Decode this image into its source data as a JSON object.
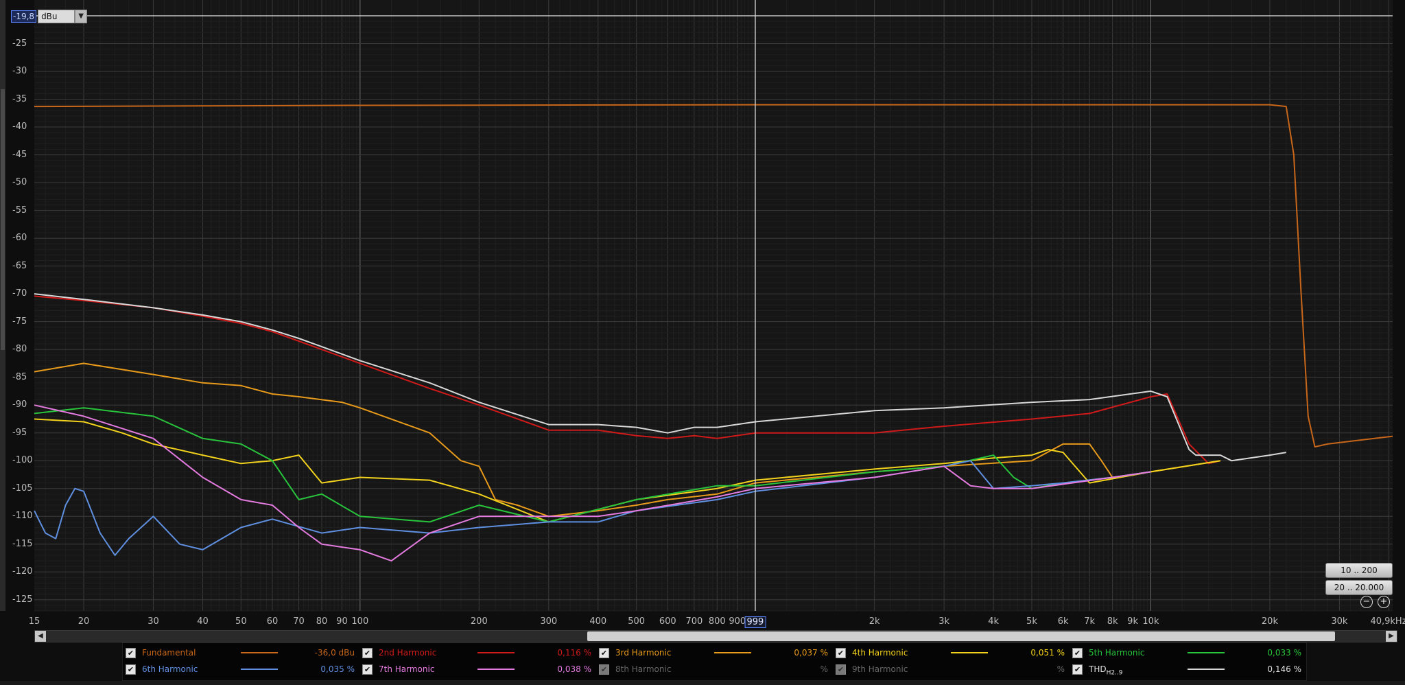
{
  "unit": {
    "cursor_level": "-19,8",
    "selected": "dBu"
  },
  "y_ticks": [
    "-25",
    "-30",
    "-35",
    "-40",
    "-45",
    "-50",
    "-55",
    "-60",
    "-65",
    "-70",
    "-75",
    "-80",
    "-85",
    "-90",
    "-95",
    "-100",
    "-105",
    "-110",
    "-115",
    "-120",
    "-125"
  ],
  "x_ticks": [
    "15",
    "20",
    "30",
    "40",
    "50",
    "60",
    "70",
    "80",
    "90",
    "100",
    "200",
    "300",
    "400",
    "500",
    "600",
    "700",
    "800",
    "900",
    "999",
    "2k",
    "3k",
    "4k",
    "5k",
    "6k",
    "7k",
    "8k",
    "9k",
    "10k",
    "20k",
    "30k",
    "40,9kHz"
  ],
  "cursor_freq": "999",
  "buttons": {
    "range_1": "10 .. 200",
    "range_2": "20 .. 20.000"
  },
  "legend": [
    {
      "name": "Fundamental",
      "value": "-36,0 dBu",
      "color": "#c8661a",
      "checked": true,
      "enabled": true
    },
    {
      "name": "2nd Harmonic",
      "value": "0,116 %",
      "color": "#d01a1a",
      "checked": true,
      "enabled": true
    },
    {
      "name": "3rd Harmonic",
      "value": "0,037 %",
      "color": "#e89a1a",
      "checked": true,
      "enabled": true
    },
    {
      "name": "4th Harmonic",
      "value": "0,051 %",
      "color": "#f2d21c",
      "checked": true,
      "enabled": true
    },
    {
      "name": "5th Harmonic",
      "value": "0,033 %",
      "color": "#28c43c",
      "checked": true,
      "enabled": true
    },
    {
      "name": "6th Harmonic",
      "value": "0,035 %",
      "color": "#5f8fe0",
      "checked": true,
      "enabled": true
    },
    {
      "name": "7th Harmonic",
      "value": "0,038 %",
      "color": "#e47be0",
      "checked": true,
      "enabled": true
    },
    {
      "name": "8th Harmonic",
      "value": "%",
      "color": "#666666",
      "checked": true,
      "enabled": false
    },
    {
      "name": "9th Harmonic",
      "value": "%",
      "color": "#666666",
      "checked": true,
      "enabled": false
    },
    {
      "name": "THD",
      "name_sub": "H2..9",
      "value": "0,146 %",
      "color": "#d8d8d8",
      "checked": true,
      "enabled": true
    }
  ],
  "chart_data": {
    "type": "line",
    "title": "",
    "xlabel": "",
    "ylabel": "",
    "x_scale": "log",
    "xlim": [
      15,
      40900
    ],
    "ylim": [
      -127,
      -20
    ],
    "grid": true,
    "cursor": {
      "x": 999,
      "y": -19.8
    },
    "series": [
      {
        "name": "Fundamental",
        "color": "#c8661a",
        "x": [
          15,
          100,
          1000,
          10000,
          20000,
          22000,
          23000,
          24000,
          25000,
          26000,
          28000,
          32000,
          40900
        ],
        "y": [
          -36.3,
          -36.1,
          -36.0,
          -36.0,
          -36.0,
          -36.3,
          -45,
          -70,
          -92,
          -97.5,
          -97,
          -96.5,
          -95.6
        ]
      },
      {
        "name": "2nd Harmonic",
        "color": "#d01a1a",
        "x": [
          15,
          20,
          30,
          40,
          50,
          60,
          70,
          80,
          100,
          150,
          200,
          300,
          400,
          500,
          600,
          700,
          800,
          1000,
          2000,
          3000,
          5000,
          7000,
          10000,
          11000,
          12500,
          14000,
          15000
        ],
        "y": [
          -70.4,
          -71.2,
          -72.5,
          -74,
          -75.3,
          -76.8,
          -78.5,
          -80,
          -82.5,
          -87,
          -90,
          -94.5,
          -94.5,
          -95.5,
          -96,
          -95.5,
          -96,
          -95,
          -95,
          -93.8,
          -92.5,
          -91.5,
          -88.5,
          -88,
          -97,
          -100.5,
          -100
        ]
      },
      {
        "name": "3rd Harmonic",
        "color": "#e89a1a",
        "x": [
          15,
          20,
          30,
          40,
          50,
          60,
          70,
          90,
          100,
          150,
          180,
          200,
          220,
          250,
          300,
          400,
          500,
          600,
          800,
          1000,
          2000,
          3000,
          5000,
          6000,
          7000,
          7500,
          8000,
          10000,
          15000
        ],
        "y": [
          -84,
          -82.5,
          -84.5,
          -86,
          -86.5,
          -88,
          -88.5,
          -89.5,
          -90.5,
          -95,
          -100,
          -101,
          -107,
          -108,
          -110,
          -109,
          -108,
          -107,
          -106,
          -104,
          -102,
          -101,
          -100,
          -97,
          -97,
          -100,
          -103,
          -102,
          -100
        ]
      },
      {
        "name": "4th Harmonic",
        "color": "#f2d21c",
        "x": [
          15,
          20,
          25,
          30,
          40,
          50,
          60,
          70,
          80,
          100,
          150,
          200,
          300,
          500,
          800,
          1000,
          2000,
          3000,
          4000,
          5000,
          5500,
          6000,
          7000,
          10000,
          15000
        ],
        "y": [
          -92.5,
          -93,
          -95,
          -97,
          -99,
          -100.5,
          -100,
          -99,
          -104,
          -103,
          -103.5,
          -106,
          -111,
          -107,
          -105,
          -103.5,
          -101.5,
          -100.5,
          -99.5,
          -99,
          -98,
          -98.5,
          -104,
          -102,
          -100
        ]
      },
      {
        "name": "5th Harmonic",
        "color": "#28c43c",
        "x": [
          15,
          20,
          30,
          40,
          50,
          60,
          70,
          80,
          100,
          150,
          200,
          300,
          500,
          800,
          1000,
          2000,
          3000,
          4000,
          4500,
          5000,
          6000,
          8000,
          10000
        ],
        "y": [
          -91.5,
          -90.5,
          -92,
          -96,
          -97,
          -100,
          -107,
          -106,
          -110,
          -111,
          -108,
          -111,
          -107,
          -104.5,
          -104.5,
          -102,
          -101,
          -99,
          -103,
          -105,
          -104,
          -103,
          -102
        ]
      },
      {
        "name": "6th Harmonic",
        "color": "#5f8fe0",
        "x": [
          15,
          16,
          17,
          18,
          19,
          20,
          22,
          24,
          26,
          30,
          35,
          40,
          50,
          60,
          80,
          100,
          150,
          200,
          300,
          400,
          500,
          800,
          1000,
          2000,
          3000,
          3500,
          4000,
          5000,
          6000,
          8000,
          10000
        ],
        "y": [
          -109,
          -113,
          -114,
          -108,
          -105,
          -105.5,
          -113,
          -117,
          -114,
          -110,
          -115,
          -116,
          -112,
          -110.5,
          -113,
          -112,
          -113,
          -112,
          -111,
          -111,
          -109,
          -107,
          -105.5,
          -103,
          -101,
          -100,
          -105,
          -104.5,
          -104,
          -103,
          -102
        ]
      },
      {
        "name": "7th Harmonic",
        "color": "#e47be0",
        "x": [
          15,
          20,
          30,
          40,
          50,
          60,
          70,
          80,
          100,
          120,
          150,
          200,
          300,
          400,
          500,
          800,
          1000,
          2000,
          3000,
          3500,
          4000,
          5000,
          8000,
          10000
        ],
        "y": [
          -90,
          -92,
          -96,
          -103,
          -107,
          -108,
          -112,
          -115,
          -116,
          -118,
          -113,
          -110,
          -110,
          -110,
          -109,
          -106.5,
          -105,
          -103,
          -101,
          -104.5,
          -105,
          -105,
          -103,
          -102
        ]
      },
      {
        "name": "THD",
        "color": "#d8d8d8",
        "x": [
          15,
          20,
          30,
          40,
          50,
          60,
          70,
          80,
          100,
          150,
          200,
          300,
          400,
          500,
          600,
          700,
          800,
          1000,
          2000,
          3000,
          5000,
          7000,
          10000,
          11000,
          12500,
          13000,
          14000,
          15000,
          16000,
          20000,
          22000
        ],
        "y": [
          -70,
          -71,
          -72.5,
          -73.8,
          -75,
          -76.5,
          -78,
          -79.5,
          -82,
          -86,
          -89.5,
          -93.5,
          -93.5,
          -94,
          -95,
          -94,
          -94,
          -93,
          -91,
          -90.5,
          -89.5,
          -89,
          -87.5,
          -88.5,
          -98,
          -99,
          -99,
          -99,
          -100,
          -99,
          -98.5
        ]
      }
    ]
  }
}
